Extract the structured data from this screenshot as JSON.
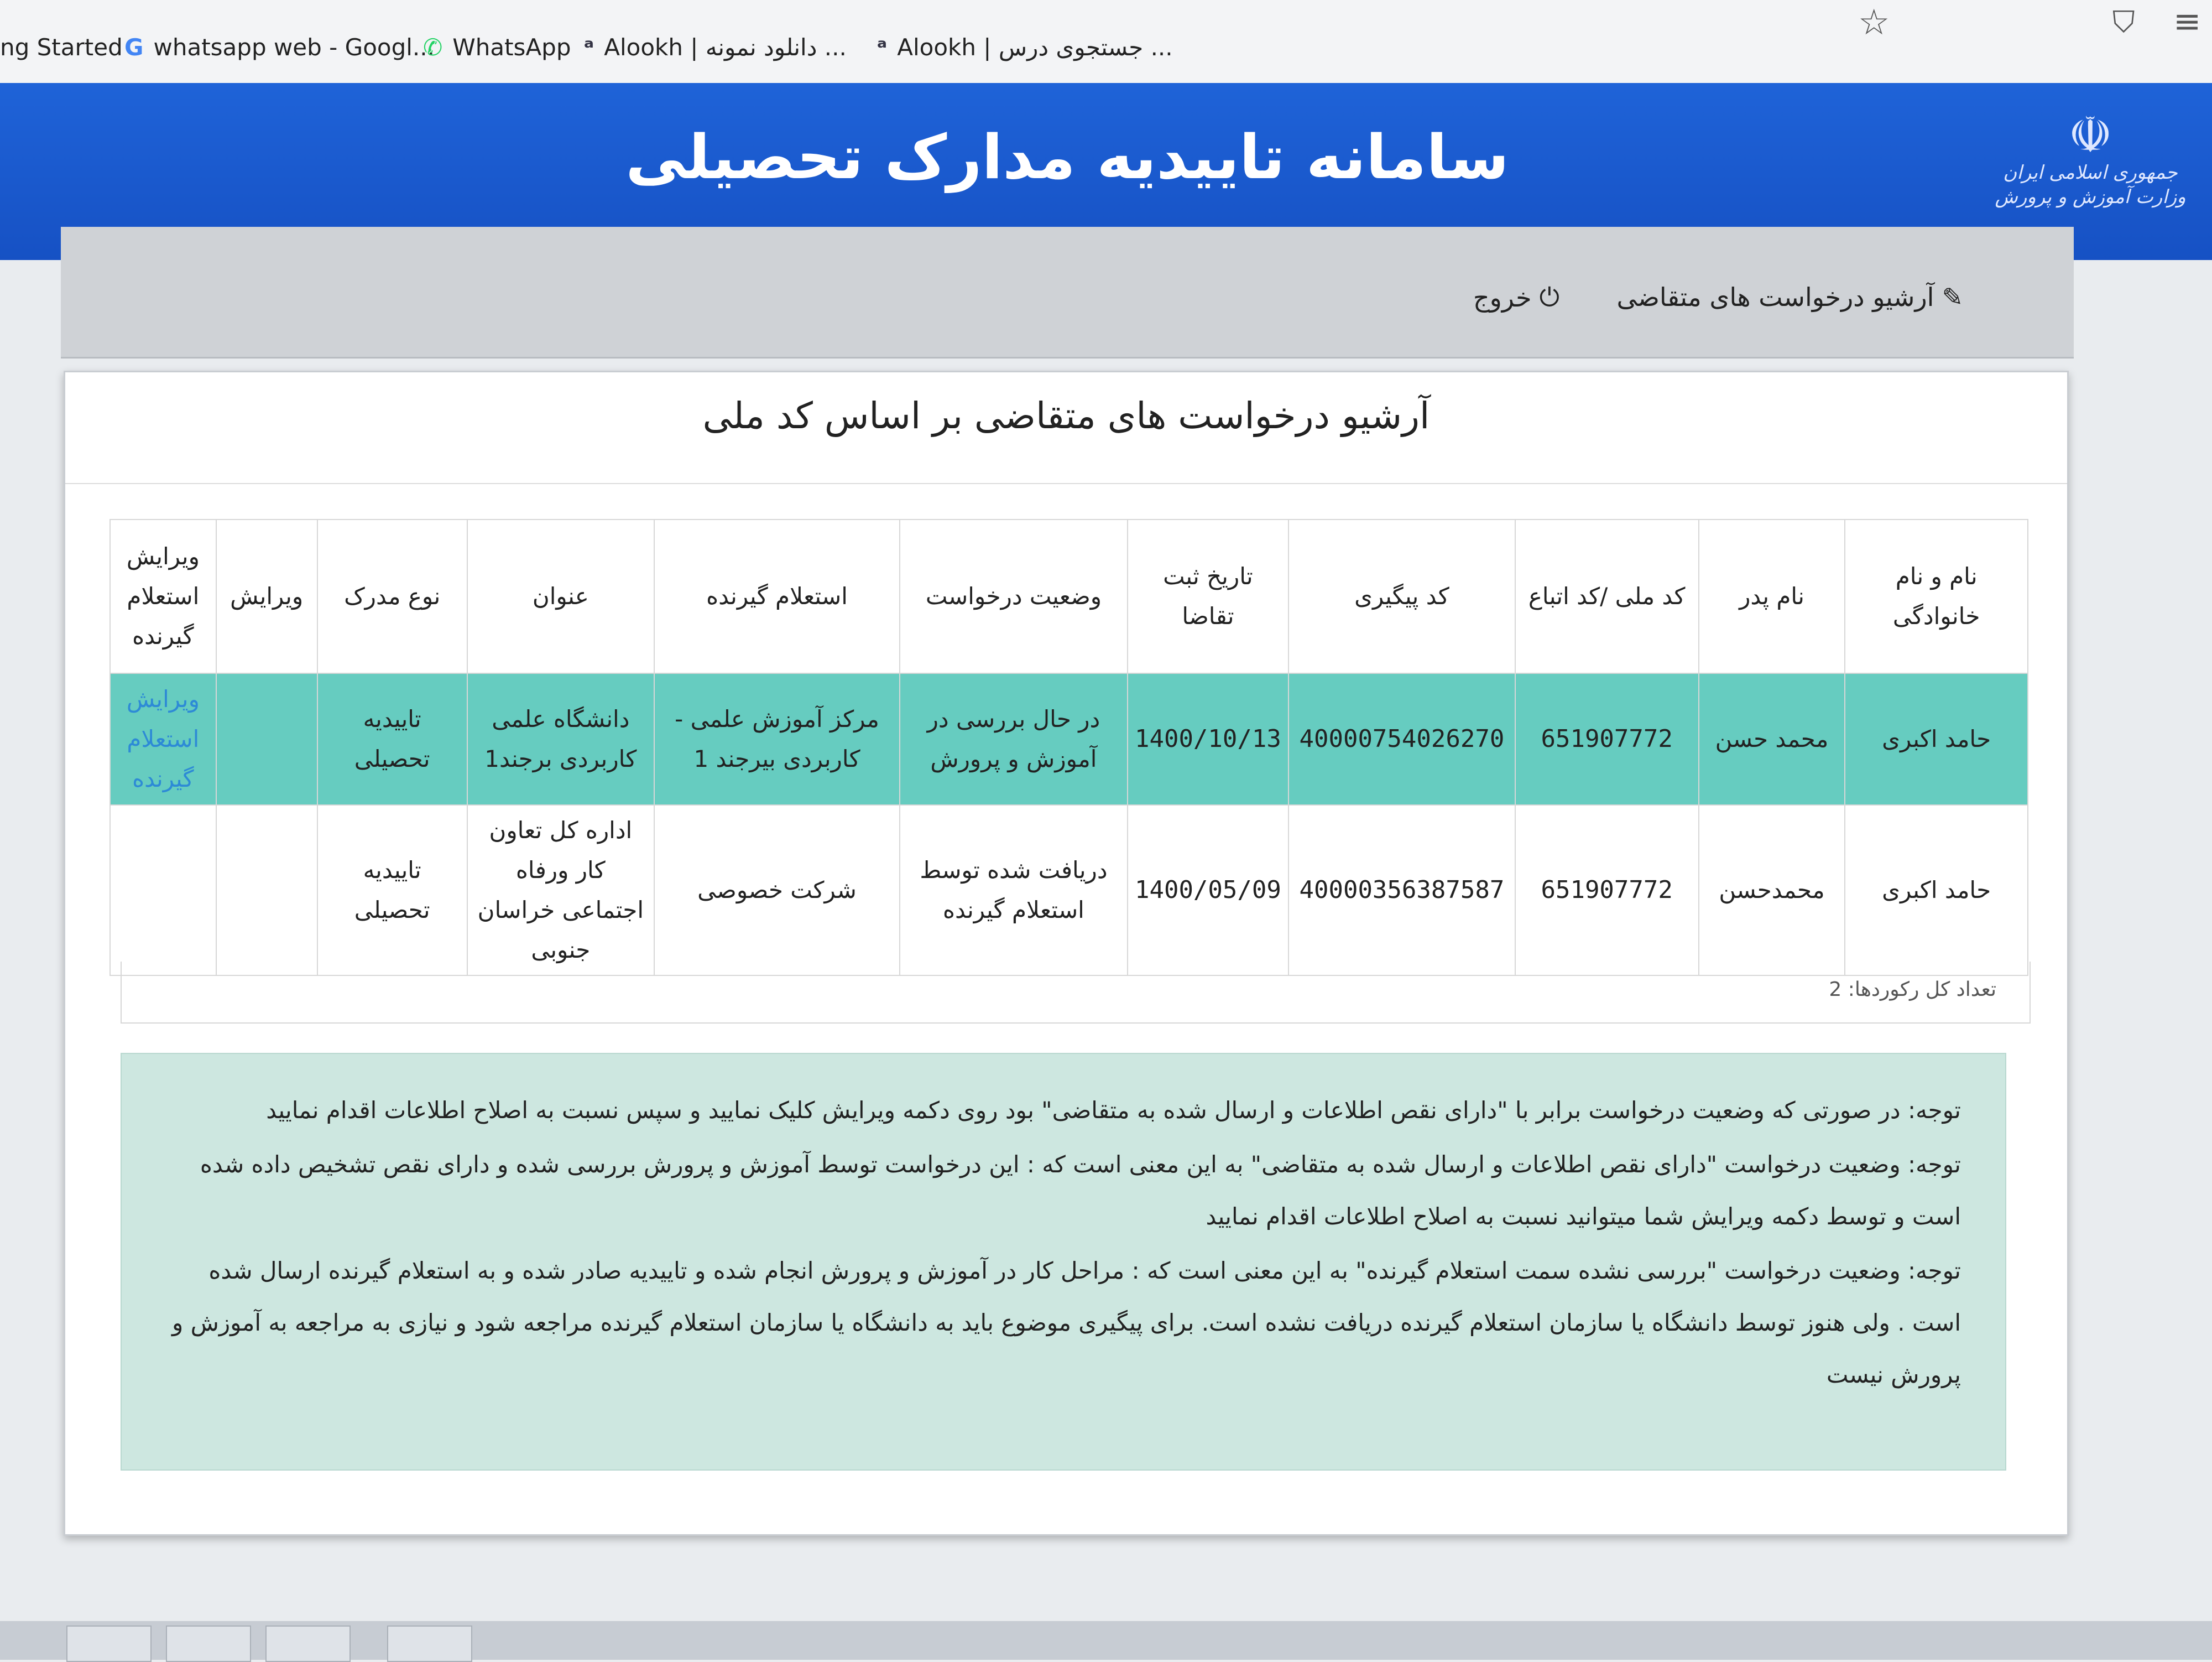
{
  "browser": {
    "bookmarks": [
      {
        "icon": "",
        "label": "ng Started"
      },
      {
        "icon": "G",
        "label": "whatsapp web - Googl..."
      },
      {
        "icon": "✆",
        "label": "WhatsApp"
      },
      {
        "icon": "ᵃ",
        "label": "Alookh | دانلود نمونه ..."
      },
      {
        "icon": "ᵃ",
        "label": "Alookh | جستجوی درس ..."
      }
    ]
  },
  "header": {
    "title": "سامانه تاییدیه مدارک تحصیلی",
    "logo_caption": "جمهوری اسلامی ایران وزارت آموزش و پرورش"
  },
  "nav": {
    "archive_label": "آرشیو درخواست های متقاضی",
    "logout_label": "خروج"
  },
  "panel": {
    "title": "آرشیو درخواست های متقاضی بر اساس کد ملی"
  },
  "table": {
    "headers": [
      "نام و نام خانوادگی",
      "نام پدر",
      "کد ملی /کد اتباع",
      "کد پیگیری",
      "تاریخ ثبت تقاضا",
      "وضعیت درخواست",
      "استعلام گیرنده",
      "عنوان",
      "نوع مدرک",
      "ویرایش",
      "ویرایش استعلام گیرنده"
    ],
    "rows": [
      {
        "name": "حامد اکبری",
        "father": "محمد حسن",
        "national_id": "651907772",
        "tracking_code": "40000754026270",
        "date": "1400/10/13",
        "status": "در حال بررسی در آموزش و پرورش",
        "receiver": "مرکز آموزش علمی - کاربردی بیرجند 1",
        "title": "دانشگاه علمی کاربردی برجند1",
        "doc_type": "تاییدیه تحصیلی",
        "edit": "",
        "edit_receiver": "ویرایش استعلام گیرنده"
      },
      {
        "name": "حامد اکبری",
        "father": "محمدحسن",
        "national_id": "651907772",
        "tracking_code": "40000356387587",
        "date": "1400/05/09",
        "status": "دریافت شده توسط استعلام گیرنده",
        "receiver": "شرکت خصوصی",
        "title": "اداره کل تعاون کار ورفاه اجتماعی خراسان جنوبی",
        "doc_type": "تاییدیه تحصیلی",
        "edit": "",
        "edit_receiver": ""
      }
    ],
    "record_count_label": "تعداد کل رکوردها: 2"
  },
  "notes": [
    "توجه: در صورتی که وضعیت درخواست برابر با \"دارای نقص اطلاعات و ارسال شده به متقاضی\" بود روی دکمه ویرایش کلیک نمایید و سپس نسبت به اصلاح اطلاعات اقدام نمایید",
    "توجه: وضعیت درخواست \"دارای نقص اطلاعات و ارسال شده به متقاضی\" به این معنی است که : این درخواست توسط آموزش و پرورش بررسی شده و دارای نقص تشخیص داده شده است و توسط دکمه ویرایش شما میتوانید نسبت به اصلاح اطلاعات اقدام نمایید",
    "توجه: وضعیت درخواست \"بررسی نشده سمت استعلام گیرنده\" به این معنی است که : مراحل کار در آموزش و پرورش انجام شده و تاییدیه صادر شده و به استعلام گیرنده ارسال شده است . ولی هنوز توسط دانشگاه یا سازمان استعلام گیرنده دریافت نشده است. برای پیگیری موضوع باید به دانشگاه یا سازمان استعلام گیرنده مراجعه شود و نیازی به مراجعه به آموزش و پرورش نیست"
  ],
  "colors": {
    "banner": "#1f63d8",
    "active_row": "#66ccc0",
    "notes_bg": "#cde7e0",
    "link": "#2d8ad6"
  }
}
